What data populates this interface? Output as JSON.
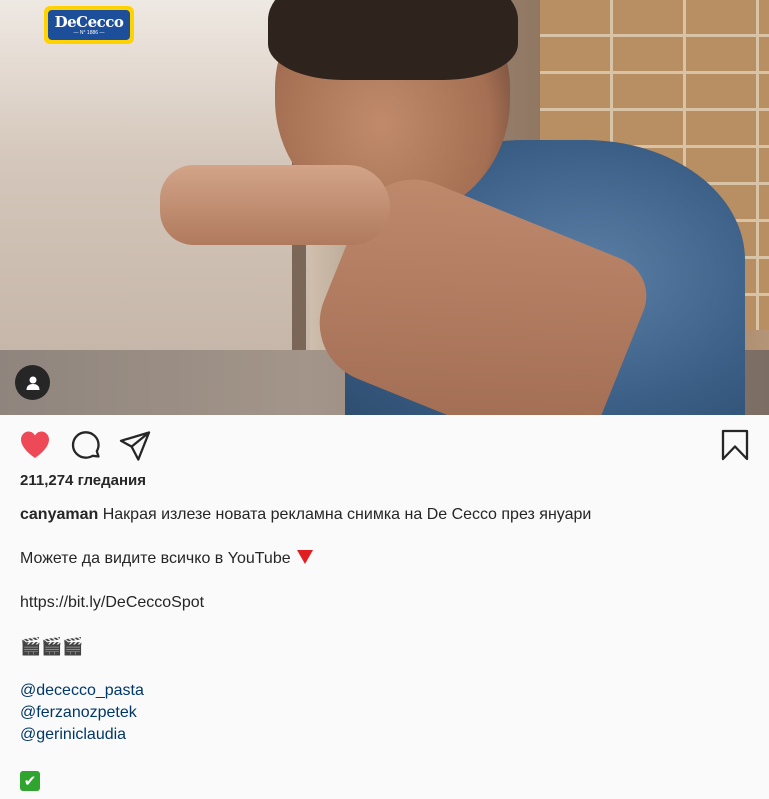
{
  "post": {
    "brand_logo": {
      "text": "DeCecco",
      "subtext": "— N° 1886 —"
    },
    "tag_icon": "person-icon",
    "actions": {
      "like_icon": "heart-filled-icon",
      "like_color": "#ed4956",
      "comment_icon": "comment-icon",
      "share_icon": "paper-plane-icon",
      "save_icon": "bookmark-icon"
    },
    "views": {
      "count": "211,274",
      "label": "гледания"
    },
    "caption": {
      "username": "canyaman",
      "text": "Накрая излезе новата рекламна снимка на De Cecco през януари",
      "youtube_line": "Можете да видите всичко в YouTube",
      "youtube_emoji": "red-triangle-down-icon",
      "link": "https://bit.ly/DeCeccoSpot",
      "clapper_emoji": "🎬🎬🎬",
      "mentions": [
        "@dececco_pasta",
        "@ferzanozpetek",
        "@geriniclaudia"
      ],
      "check_emoji": "✔"
    }
  }
}
